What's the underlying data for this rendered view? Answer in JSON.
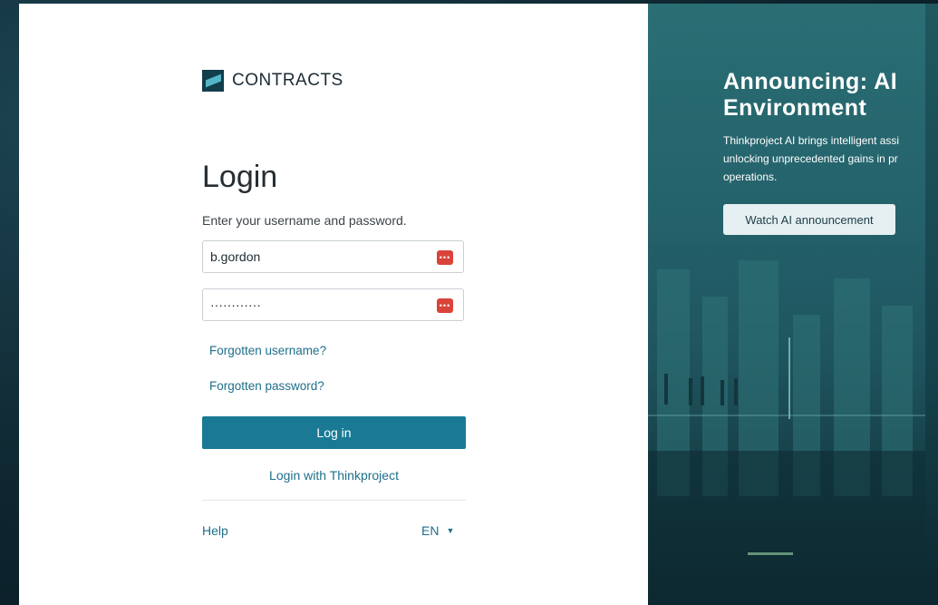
{
  "brand": {
    "name": "CONTRACTS"
  },
  "login": {
    "title": "Login",
    "subtitle": "Enter your username and password.",
    "username_value": "b.gordon",
    "password_value": "············",
    "forgot_username": "Forgotten username?",
    "forgot_password": "Forgotten password?",
    "login_button": "Log in",
    "thinkproject_link": "Login with Thinkproject",
    "help": "Help",
    "language": "EN"
  },
  "announcement": {
    "title": "Announcing: AI Environment",
    "line1": "Thinkproject AI brings intelligent assi",
    "line2": "unlocking unprecedented gains in pr",
    "line3": "operations.",
    "button": "Watch AI announcement"
  },
  "colors": {
    "accent": "#1a7a95",
    "link": "#1e6f8a",
    "password_manager_icon": "#d9443a"
  },
  "icons": {
    "password_manager": "password-manager-icon",
    "language_dropdown": "caret-down-icon"
  }
}
